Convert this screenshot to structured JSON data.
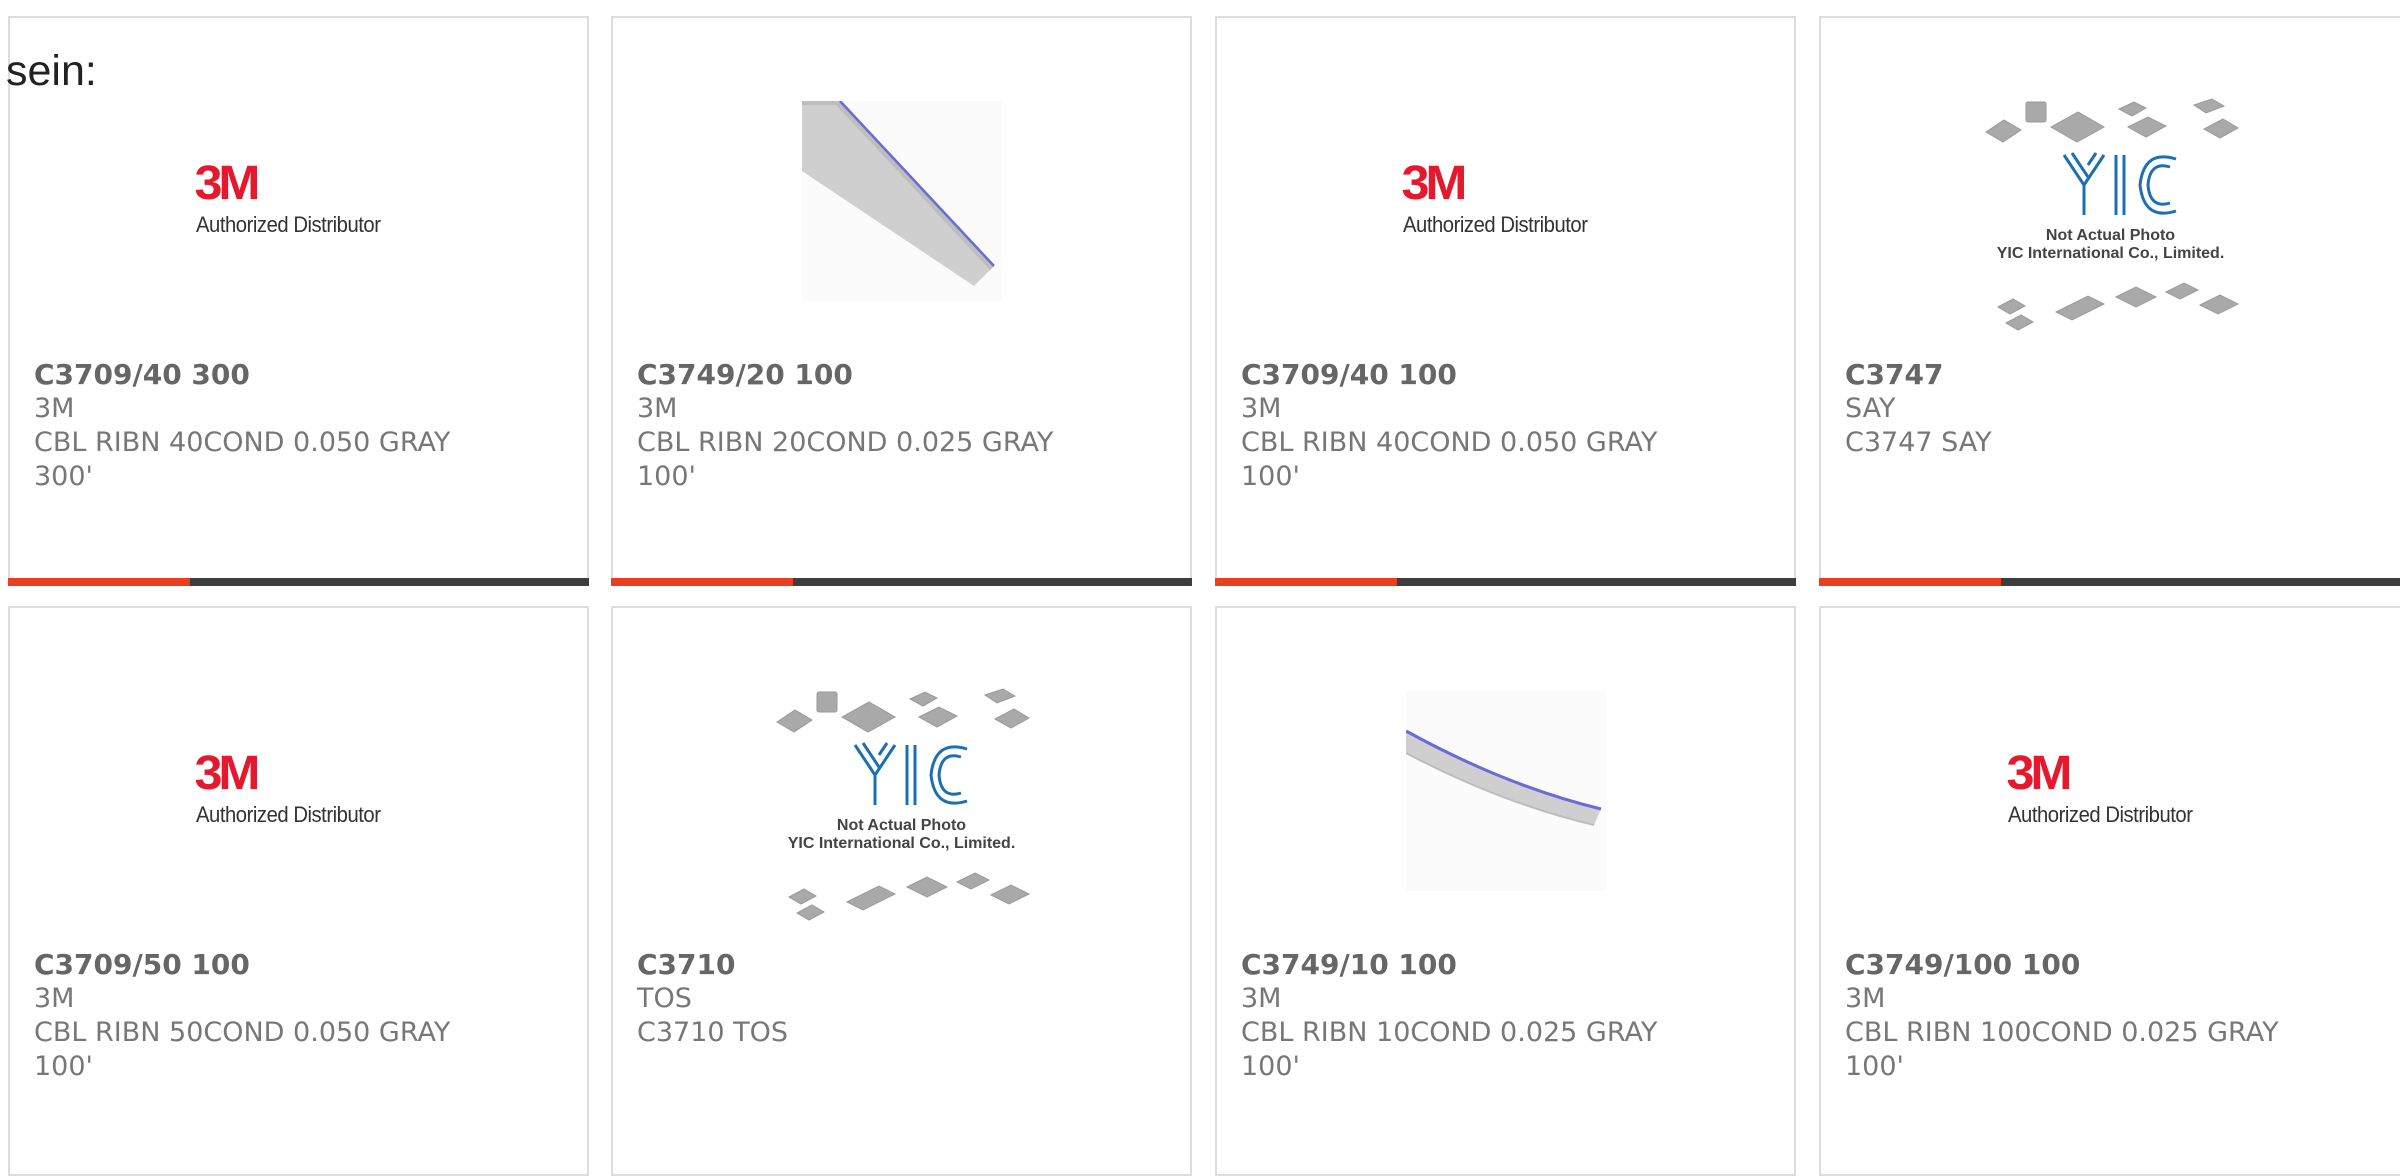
{
  "intro_text": "sein:",
  "logo_text": {
    "brand": "3M",
    "tagline": "Authorized Distributor"
  },
  "placeholder_text": {
    "line1": "Not Actual Photo",
    "line2": "YIC International Co., Limited."
  },
  "colors": {
    "accent": "#ea3f1e",
    "bar": "#3d3d3d",
    "border": "#dddddd",
    "brand_3m": "#e4192d"
  },
  "products": [
    {
      "part_number": "C3709/40 300",
      "manufacturer": "3M",
      "desc1": "CBL RIBN 40COND 0.050 GRAY",
      "desc2": "300'",
      "image": "3m-authorized-distributor-logo"
    },
    {
      "part_number": "C3749/20 100",
      "manufacturer": "3M",
      "desc1": "CBL RIBN 20COND 0.025 GRAY",
      "desc2": "100'",
      "image": "ribbon-cable-photo"
    },
    {
      "part_number": "C3709/40 100",
      "manufacturer": "3M",
      "desc1": "CBL RIBN 40COND 0.050 GRAY",
      "desc2": "100'",
      "image": "3m-authorized-distributor-logo"
    },
    {
      "part_number": "C3747",
      "manufacturer": "SAY",
      "desc1": "C3747 SAY",
      "desc2": "",
      "image": "not-actual-photo-placeholder"
    },
    {
      "part_number": "C3709/50 100",
      "manufacturer": "3M",
      "desc1": "CBL RIBN 50COND 0.050 GRAY",
      "desc2": "100'",
      "image": "3m-authorized-distributor-logo"
    },
    {
      "part_number": "C3710",
      "manufacturer": "TOS",
      "desc1": "C3710 TOS",
      "desc2": "",
      "image": "not-actual-photo-placeholder"
    },
    {
      "part_number": "C3749/10 100",
      "manufacturer": "3M",
      "desc1": "CBL RIBN 10COND 0.025 GRAY",
      "desc2": "100'",
      "image": "ribbon-cable-photo"
    },
    {
      "part_number": "C3749/100 100",
      "manufacturer": "3M",
      "desc1": "CBL RIBN 100COND 0.025 GRAY",
      "desc2": "100'",
      "image": "3m-authorized-distributor-logo"
    }
  ]
}
